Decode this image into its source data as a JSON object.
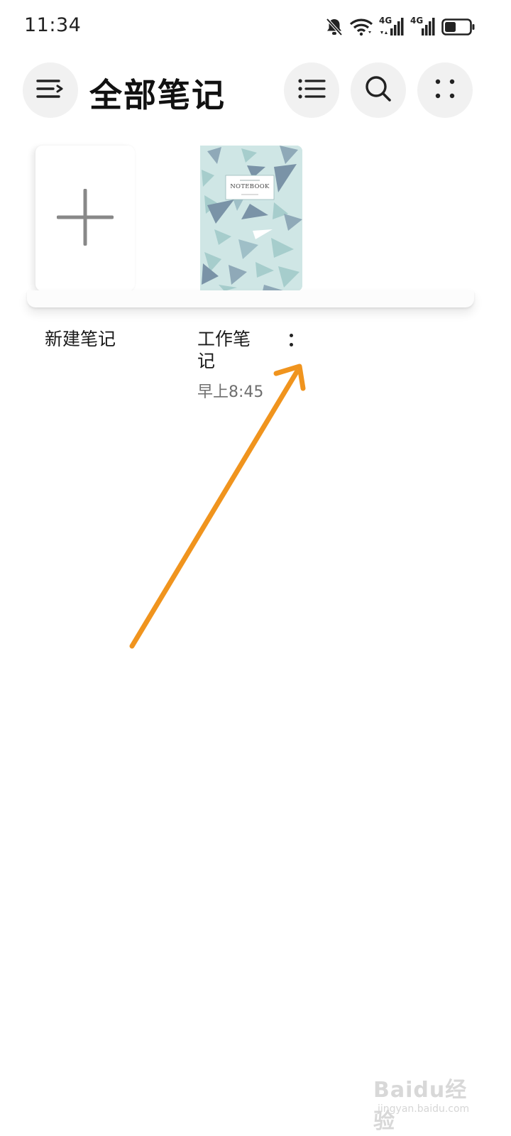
{
  "status_bar": {
    "time": "11:34",
    "network_1": "4G",
    "network_2": "4G",
    "icons": [
      "bell-off-icon",
      "wifi-icon",
      "signal-4g-icon",
      "signal-4g-icon",
      "battery-icon"
    ],
    "battery_level": 0.4
  },
  "header": {
    "title": "全部笔记",
    "icons": [
      "menu-icon",
      "list-icon",
      "search-icon",
      "more-dots-icon"
    ]
  },
  "shelf": {
    "new_note_label": "新建笔记",
    "notebook": {
      "cover_title": "NOTEBOOK",
      "title": "工作笔记",
      "time": "早上8:45"
    }
  },
  "watermark": {
    "main": "Baidu经验",
    "sub": "jingyan.baidu.com"
  },
  "colors": {
    "background": "#ffffff",
    "button_bg": "#f1f1f1",
    "arrow": "#f0941e",
    "cover_bg": "#cfe6e5"
  }
}
